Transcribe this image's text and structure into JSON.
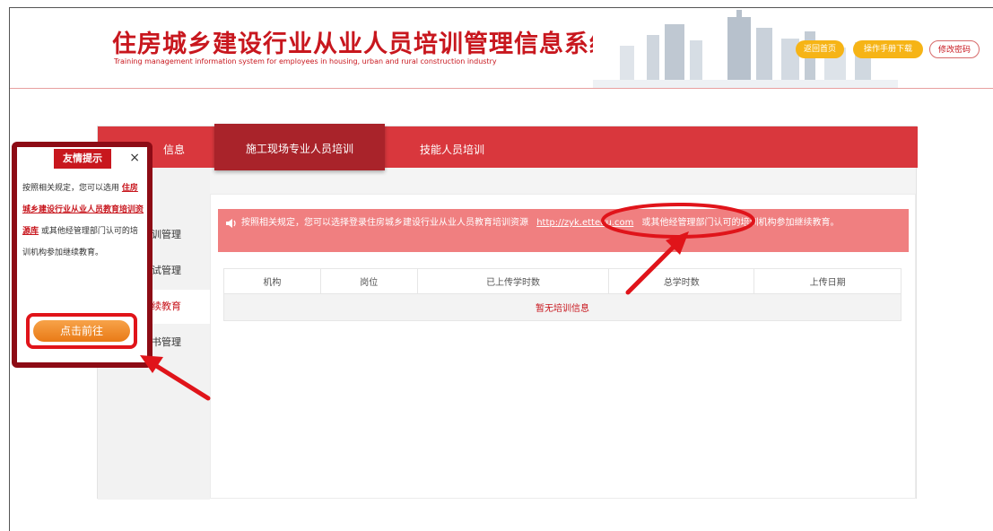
{
  "header": {
    "title": "住房城乡建设行业从业人员培训管理信息系统",
    "subtitle": "Training management information system for employees in housing, urban and rural construction industry",
    "buttons": [
      "返回首页",
      "操作手册下载",
      "修改密码"
    ]
  },
  "tabs": [
    "信息",
    "施工现场专业人员培训",
    "技能人员培训"
  ],
  "sidebar": [
    "训管理",
    "试管理",
    "续教育",
    "书管理"
  ],
  "notice": {
    "text_before": "按照相关规定，您可以选择登录住房城乡建设行业从业人员教育培训资源",
    "link": "http://zyk.ettedu.com",
    "text_after": "或其他经管理部门认可的培训机构参加继续教育。"
  },
  "table": {
    "headers": [
      "机构",
      "岗位",
      "已上传学时数",
      "总学时数",
      "上传日期"
    ],
    "empty_text": "暂无培训信息"
  },
  "popup": {
    "tag": "友情提示",
    "close": "×",
    "text_before": "按照相关规定，您可以选用",
    "link": "住房城乡建设行业从业人员教育培训资源库",
    "text_after": "或其他经管理部门认可的培训机构参加继续教育。",
    "button": "点击前往"
  },
  "colors": {
    "brand_red": "#c8171e",
    "tab_bar": "#d9373d",
    "tab_active": "#a9232a",
    "notice_bg": "#f07f80",
    "annotation_red": "#e0141a",
    "button_orange": "#e97a16",
    "button_yellow": "#f6b416"
  }
}
